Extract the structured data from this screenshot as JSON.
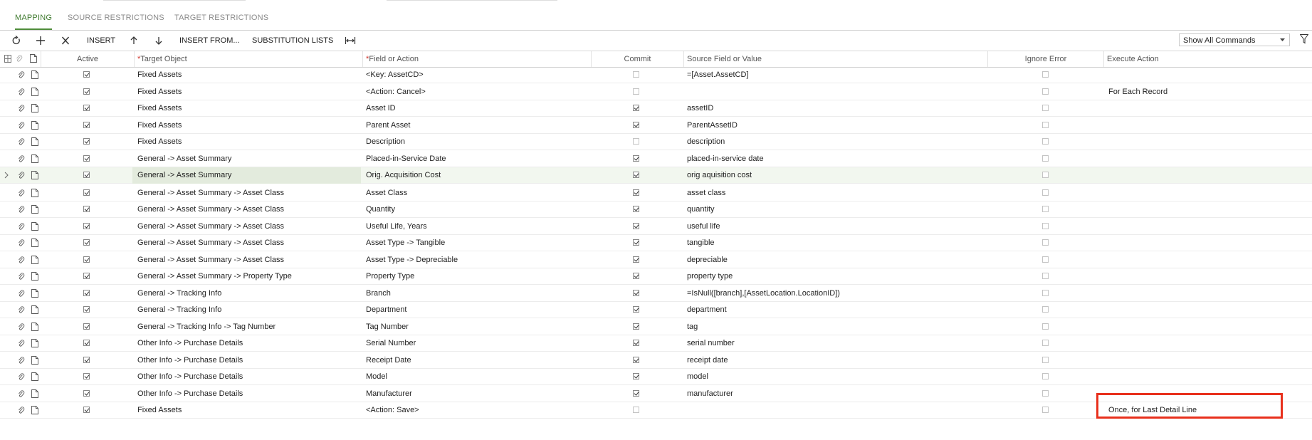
{
  "tabs": [
    {
      "label": "MAPPING",
      "active": true
    },
    {
      "label": "SOURCE RESTRICTIONS",
      "active": false
    },
    {
      "label": "TARGET RESTRICTIONS",
      "active": false
    }
  ],
  "toolbar": {
    "refresh_icon": "refresh-icon",
    "add_icon": "plus-icon",
    "delete_icon": "close-icon",
    "insert_label": "INSERT",
    "move_up_icon": "arrow-up-icon",
    "move_down_icon": "arrow-down-icon",
    "insert_from_label": "INSERT FROM...",
    "substitution_lists_label": "SUBSTITUTION LISTS",
    "fit_columns_icon": "fit-columns-icon",
    "commands_select": "Show All Commands"
  },
  "columns": {
    "active": "Active",
    "target_object": "Target Object",
    "field_or_action": "Field or Action",
    "commit": "Commit",
    "source_field": "Source Field or Value",
    "ignore_error": "Ignore Error",
    "execute_action": "Execute Action"
  },
  "rows": [
    {
      "active": true,
      "target": "Fixed Assets",
      "field": "<Key: AssetCD>",
      "commit": false,
      "source": "=[Asset.AssetCD]",
      "ignore": false,
      "execute": ""
    },
    {
      "active": true,
      "target": "Fixed Assets",
      "field": "<Action: Cancel>",
      "commit": false,
      "source": "",
      "ignore": false,
      "execute": "For Each Record"
    },
    {
      "active": true,
      "target": "Fixed Assets",
      "field": "Asset ID",
      "commit": true,
      "source": "assetID",
      "ignore": false,
      "execute": ""
    },
    {
      "active": true,
      "target": "Fixed Assets",
      "field": "Parent Asset",
      "commit": true,
      "source": "ParentAssetID",
      "ignore": false,
      "execute": ""
    },
    {
      "active": true,
      "target": "Fixed Assets",
      "field": "Description",
      "commit": false,
      "source": "description",
      "ignore": false,
      "execute": ""
    },
    {
      "active": true,
      "target": "General -> Asset Summary",
      "field": "Placed-in-Service Date",
      "commit": true,
      "source": "placed-in-service date",
      "ignore": false,
      "execute": ""
    },
    {
      "active": true,
      "target": "General -> Asset Summary",
      "field": "Orig. Acquisition Cost",
      "commit": true,
      "source": "orig aquisition cost",
      "ignore": false,
      "execute": "",
      "selected": true
    },
    {
      "active": true,
      "target": "General -> Asset Summary -> Asset Class",
      "field": "Asset Class",
      "commit": true,
      "source": "asset class",
      "ignore": false,
      "execute": ""
    },
    {
      "active": true,
      "target": "General -> Asset Summary -> Asset Class",
      "field": "Quantity",
      "commit": true,
      "source": "quantity",
      "ignore": false,
      "execute": ""
    },
    {
      "active": true,
      "target": "General -> Asset Summary -> Asset Class",
      "field": "Useful Life, Years",
      "commit": true,
      "source": "useful life",
      "ignore": false,
      "execute": ""
    },
    {
      "active": true,
      "target": "General -> Asset Summary -> Asset Class",
      "field": "Asset Type -> Tangible",
      "commit": true,
      "source": "tangible",
      "ignore": false,
      "execute": ""
    },
    {
      "active": true,
      "target": "General -> Asset Summary -> Asset Class",
      "field": "Asset Type -> Depreciable",
      "commit": true,
      "source": "depreciable",
      "ignore": false,
      "execute": ""
    },
    {
      "active": true,
      "target": "General -> Asset Summary -> Property Type",
      "field": "Property Type",
      "commit": true,
      "source": "property type",
      "ignore": false,
      "execute": ""
    },
    {
      "active": true,
      "target": "General -> Tracking Info",
      "field": "Branch",
      "commit": true,
      "source": "=IsNull([branch],[AssetLocation.LocationID])",
      "ignore": false,
      "execute": ""
    },
    {
      "active": true,
      "target": "General -> Tracking Info",
      "field": "Department",
      "commit": true,
      "source": "department",
      "ignore": false,
      "execute": ""
    },
    {
      "active": true,
      "target": "General -> Tracking Info -> Tag Number",
      "field": "Tag Number",
      "commit": true,
      "source": "tag",
      "ignore": false,
      "execute": ""
    },
    {
      "active": true,
      "target": "Other Info -> Purchase Details",
      "field": "Serial Number",
      "commit": true,
      "source": "serial number",
      "ignore": false,
      "execute": ""
    },
    {
      "active": true,
      "target": "Other Info -> Purchase Details",
      "field": "Receipt Date",
      "commit": true,
      "source": "receipt date",
      "ignore": false,
      "execute": ""
    },
    {
      "active": true,
      "target": "Other Info -> Purchase Details",
      "field": "Model",
      "commit": true,
      "source": "model",
      "ignore": false,
      "execute": ""
    },
    {
      "active": true,
      "target": "Other Info -> Purchase Details",
      "field": "Manufacturer",
      "commit": true,
      "source": "manufacturer",
      "ignore": false,
      "execute": ""
    },
    {
      "active": true,
      "target": "Fixed Assets",
      "field": "<Action: Save>",
      "commit": false,
      "source": "",
      "ignore": false,
      "execute": "Once, for Last Detail Line"
    }
  ],
  "highlight_color": "#e8301c",
  "accent_color": "#4e8c3a"
}
